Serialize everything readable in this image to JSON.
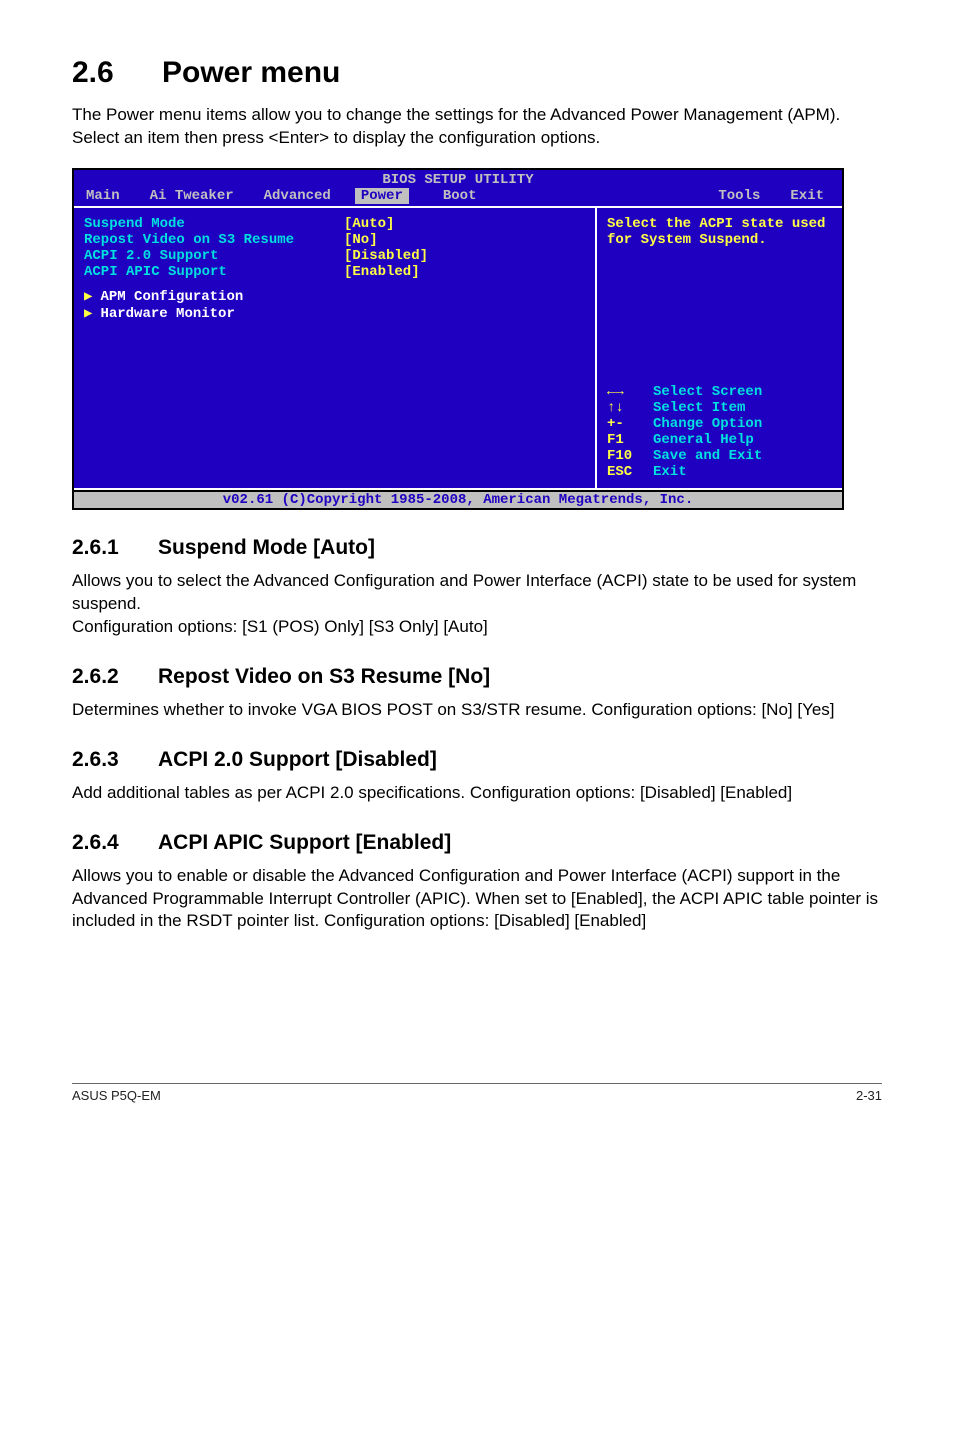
{
  "section": {
    "number": "2.6",
    "title": "Power menu",
    "intro": "The Power menu items allow you to change the settings for the Advanced Power Management (APM). Select an item then press <Enter> to display the configuration options."
  },
  "bios": {
    "header": "BIOS SETUP UTILITY",
    "tabs": [
      "Main",
      "Ai Tweaker",
      "Advanced",
      "Power",
      "Boot",
      "Tools",
      "Exit"
    ],
    "active_tab": "Power",
    "items": [
      {
        "label": "Suspend Mode",
        "value": "[Auto]"
      },
      {
        "label": "Repost Video on S3 Resume",
        "value": "[No]"
      },
      {
        "label": "ACPI 2.0 Support",
        "value": "[Disabled]"
      },
      {
        "label": "ACPI APIC Support",
        "value": "[Enabled]"
      }
    ],
    "submenus": [
      "APM Configuration",
      "Hardware Monitor"
    ],
    "help_text": "Select the ACPI state used for System Suspend.",
    "keys": [
      {
        "sym": "←→",
        "desc": "Select Screen"
      },
      {
        "sym": "↑↓",
        "desc": "Select Item"
      },
      {
        "sym": "+-",
        "desc": "  Change Option"
      },
      {
        "sym": "F1",
        "desc": "General Help"
      },
      {
        "sym": "F10",
        "desc": "Save and Exit"
      },
      {
        "sym": "ESC",
        "desc": "Exit"
      }
    ],
    "footer": "v02.61 (C)Copyright 1985-2008, American Megatrends, Inc."
  },
  "subs": [
    {
      "num": "2.6.1",
      "title": "Suspend Mode [Auto]",
      "paras": [
        "Allows you to select the Advanced Configuration and Power Interface (ACPI) state to be used for system suspend.",
        "Configuration options: [S1 (POS) Only] [S3 Only] [Auto]"
      ]
    },
    {
      "num": "2.6.2",
      "title": "Repost Video on S3 Resume [No]",
      "paras": [
        "Determines whether to invoke VGA BIOS POST on S3/STR resume. Configuration options: [No] [Yes]"
      ]
    },
    {
      "num": "2.6.3",
      "title": "ACPI 2.0 Support [Disabled]",
      "paras": [
        "Add additional tables as per ACPI 2.0 specifications. Configuration options: [Disabled] [Enabled]"
      ]
    },
    {
      "num": "2.6.4",
      "title": "ACPI APIC Support [Enabled]",
      "paras": [
        "Allows you to enable or disable the Advanced Configuration and Power Interface (ACPI) support in the Advanced Programmable Interrupt Controller (APIC). When set to [Enabled], the ACPI APIC table pointer is included in the RSDT pointer list. Configuration options: [Disabled] [Enabled]"
      ]
    }
  ],
  "footer": {
    "left": "ASUS P5Q-EM",
    "right": "2-31"
  }
}
